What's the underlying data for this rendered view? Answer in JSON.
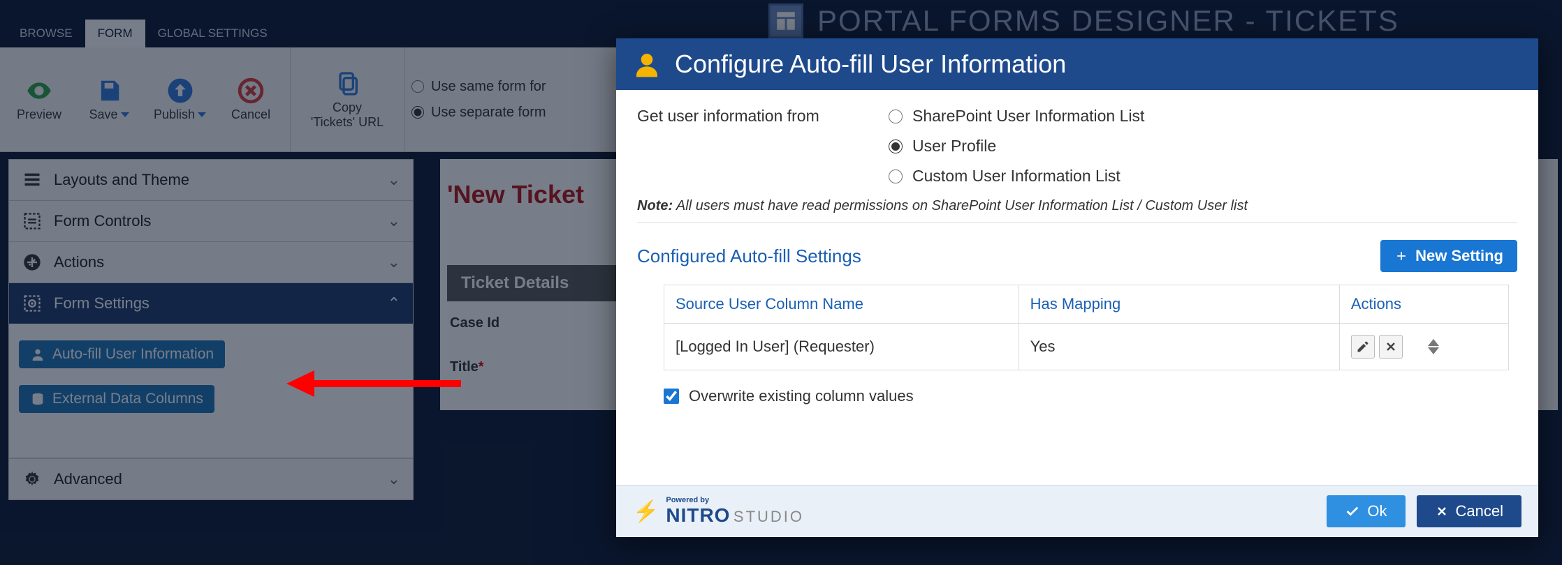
{
  "app_title": "PORTAL FORMS DESIGNER - TICKETS",
  "tabs": {
    "browse": "BROWSE",
    "form": "FORM",
    "global": "GLOBAL SETTINGS"
  },
  "ribbon": {
    "preview": "Preview",
    "save": "Save",
    "publish": "Publish",
    "cancel": "Cancel",
    "copy1": "Copy",
    "copy2": "'Tickets' URL",
    "radio_same": "Use same form for",
    "radio_separate": "Use separate form"
  },
  "accordion": {
    "layouts": "Layouts and Theme",
    "controls": "Form Controls",
    "actions": "Actions",
    "settings": "Form Settings",
    "autofill": "Auto-fill User Information",
    "external": "External Data Columns",
    "advanced": "Advanced"
  },
  "main": {
    "form_title": "'New Ticket",
    "section": "Ticket Details",
    "field_caseid": "Case Id",
    "field_title": "Title"
  },
  "modal": {
    "title": "Configure Auto-fill User Information",
    "src_label": "Get user information from",
    "opt_sp": "SharePoint User Information List",
    "opt_profile": "User Profile",
    "opt_custom": "Custom User Information List",
    "note_prefix": "Note:",
    "note_text": " All users must have read permissions on SharePoint User Information List / Custom User list",
    "section_title": "Configured Auto-fill Settings",
    "new_setting": "New Setting",
    "col_source": "Source User Column Name",
    "col_mapping": "Has Mapping",
    "col_actions": "Actions",
    "row_source": "[Logged In User] (Requester)",
    "row_mapping": "Yes",
    "overwrite": "Overwrite existing column values",
    "ok": "Ok",
    "cancel": "Cancel",
    "powered_by": "Powered by",
    "brand_nitro": "NITRO",
    "brand_studio": "STUDIO"
  }
}
